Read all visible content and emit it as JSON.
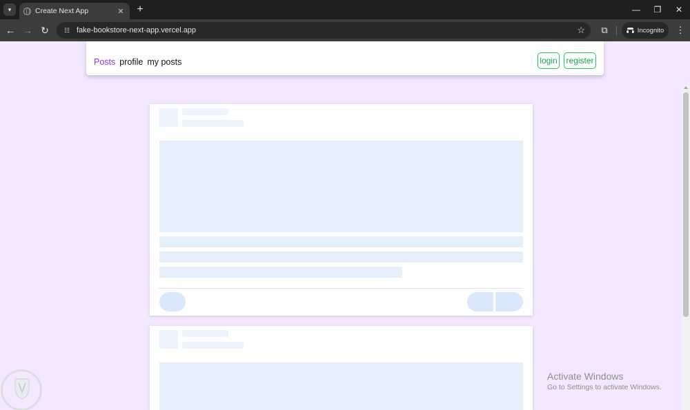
{
  "browser": {
    "tab_title": "Create Next App",
    "url": "fake-bookstore-next-app.vercel.app",
    "incognito_label": "Incognito",
    "icons": [
      "tab-search-icon",
      "globe-icon",
      "close-icon",
      "plus-icon",
      "minimize-icon",
      "restore-icon",
      "close-window-icon",
      "back-arrow-icon",
      "forward-arrow-icon",
      "reload-icon",
      "site-info-icon",
      "star-icon",
      "extensions-icon",
      "incognito-icon",
      "kebab-menu-icon"
    ]
  },
  "navbar": {
    "links": [
      {
        "label": "Posts",
        "active": true
      },
      {
        "label": "profile",
        "active": false
      },
      {
        "label": "my posts",
        "active": false
      }
    ],
    "login_label": "login",
    "register_label": "register"
  },
  "colors": {
    "page_background": "#f3e8ff",
    "active_link": "#9333ea",
    "auth_button": "#22c55e",
    "skeleton": "#eef4fd"
  },
  "overlay": {
    "watermark_title": "Activate Windows",
    "watermark_subtitle": "Go to Settings to activate Windows."
  }
}
